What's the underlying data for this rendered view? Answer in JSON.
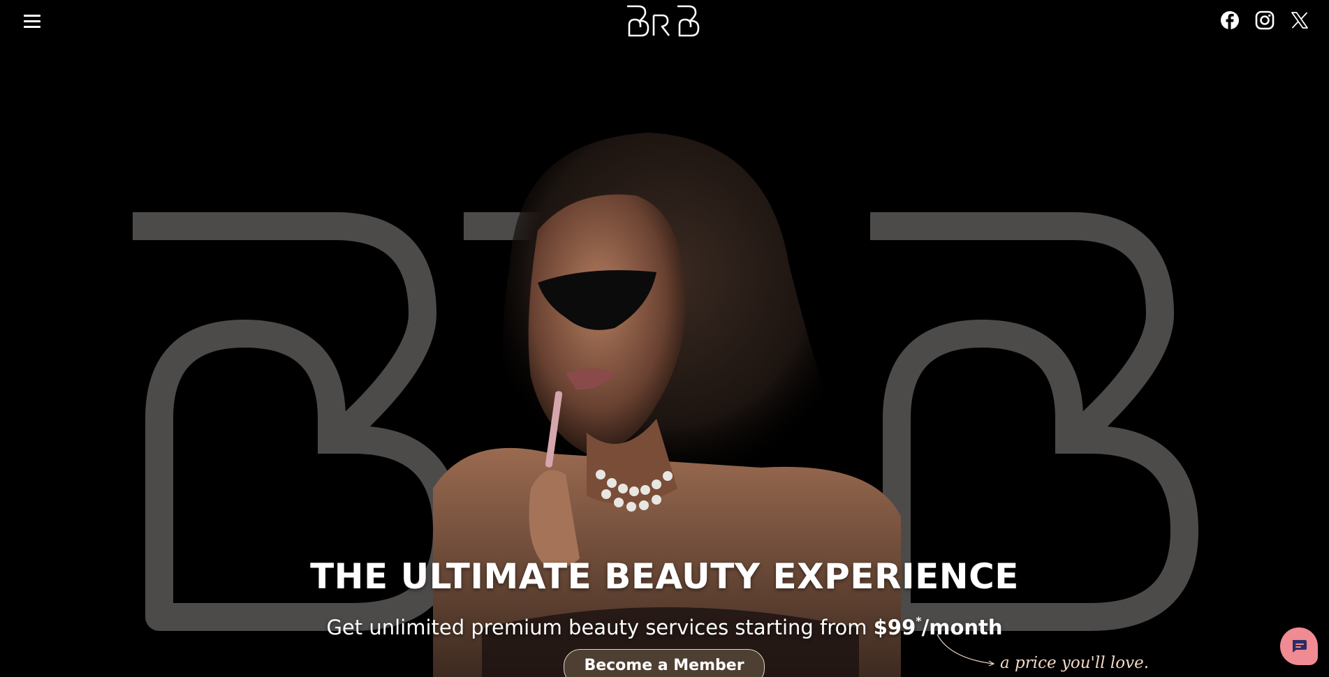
{
  "header": {
    "menu_icon": "hamburger-menu-icon",
    "logo_text": "BRB",
    "social": [
      {
        "name": "facebook",
        "icon": "facebook-icon"
      },
      {
        "name": "instagram",
        "icon": "instagram-icon"
      },
      {
        "name": "x",
        "icon": "x-twitter-icon"
      }
    ]
  },
  "hero": {
    "title": "THE ULTIMATE BEAUTY EXPERIENCE",
    "subtitle_prefix": "Get unlimited premium beauty services starting from ",
    "price": "$99",
    "price_footnote": "*",
    "price_suffix": "/month",
    "cta_label": "Become a Member",
    "tagline": "a price you'll love."
  },
  "chat": {
    "icon": "chat-bubble-icon"
  },
  "colors": {
    "background": "#000000",
    "letters": "#4d4b4a",
    "cta_border": "#e5d5c5",
    "tagline": "#f2d9c6",
    "chat": "#f08a93"
  }
}
